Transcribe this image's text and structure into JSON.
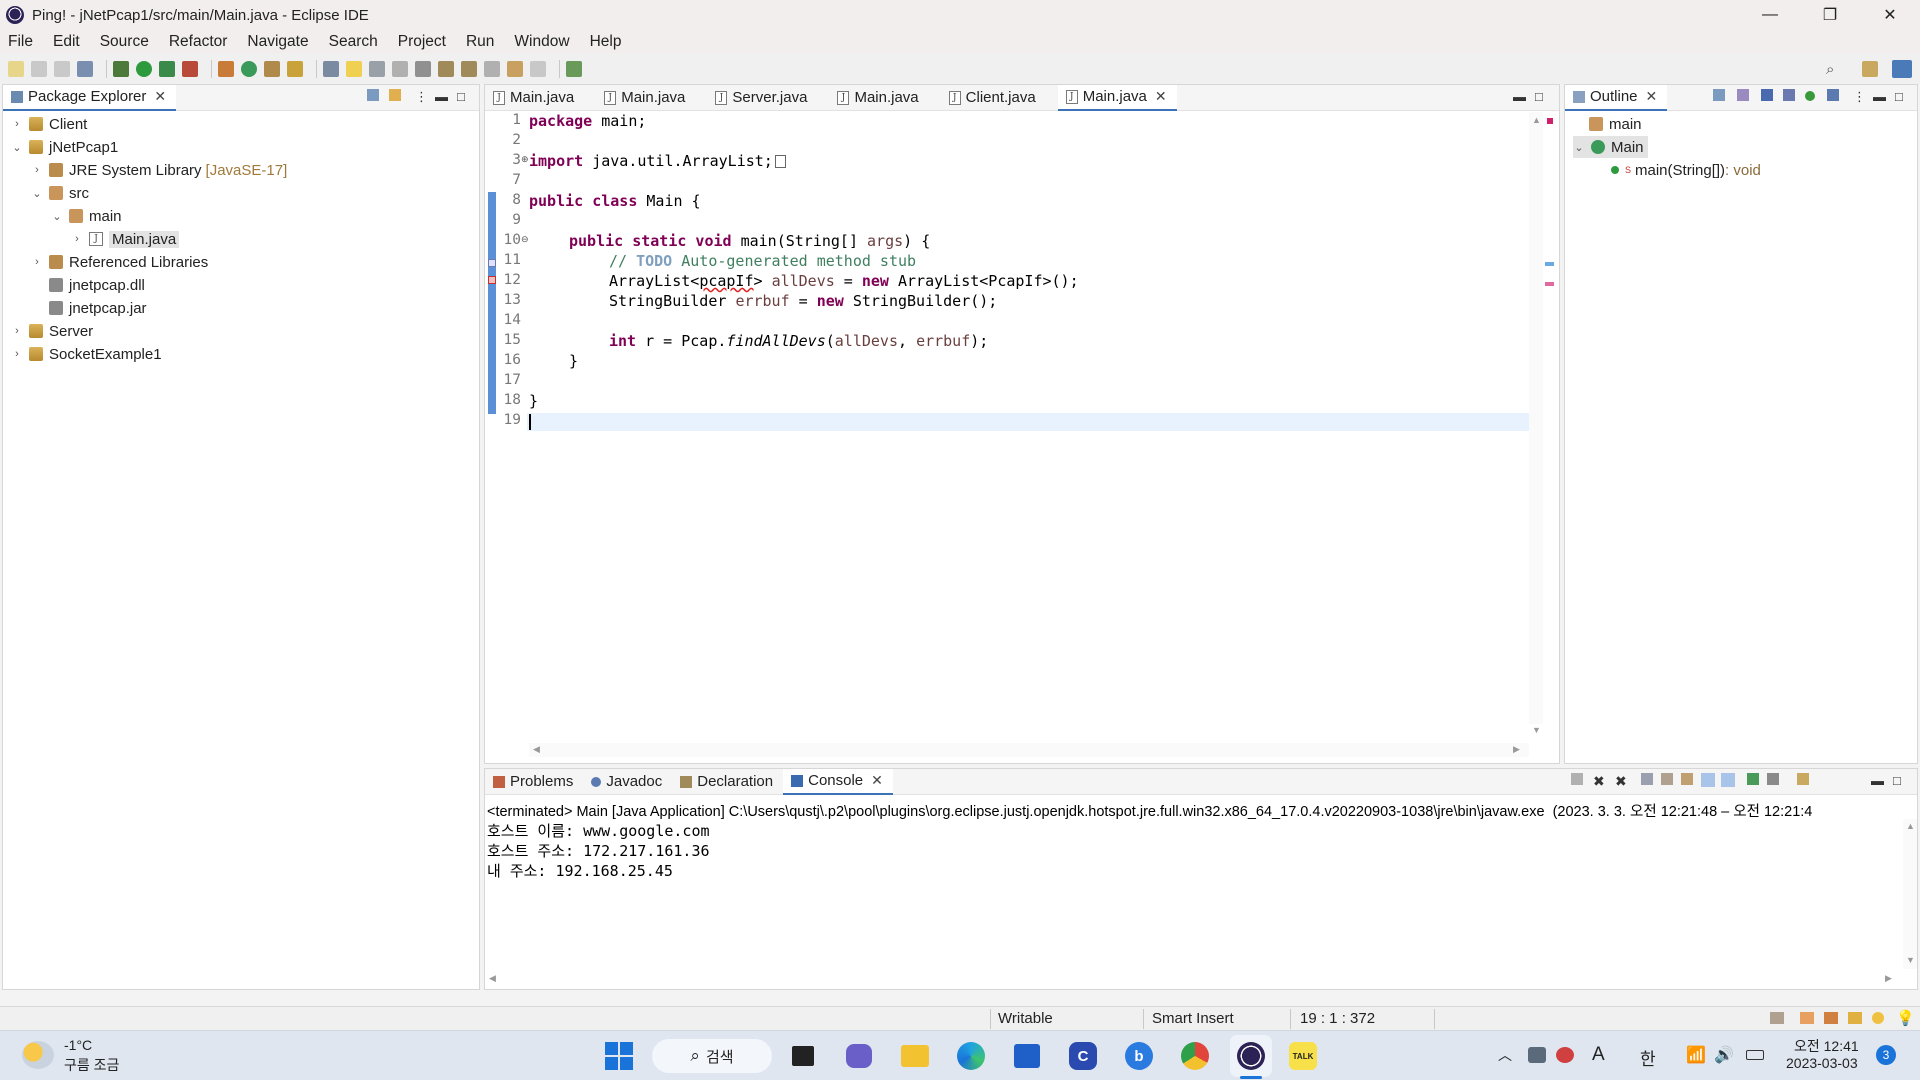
{
  "window": {
    "title": "Ping! - jNetPcap1/src/main/Main.java - Eclipse IDE",
    "minimize": "—",
    "restore": "❐",
    "close": "✕"
  },
  "menu": [
    "File",
    "Edit",
    "Source",
    "Refactor",
    "Navigate",
    "Search",
    "Project",
    "Run",
    "Window",
    "Help"
  ],
  "package_explorer": {
    "title": "Package Explorer",
    "tree": [
      {
        "label": "Client",
        "icon": "project-icon",
        "depth": 0,
        "chevron": "›"
      },
      {
        "label": "jNetPcap1",
        "icon": "project-icon",
        "depth": 0,
        "chevron": "⌄"
      },
      {
        "label": "JRE System Library",
        "suffix": "[JavaSE-17]",
        "icon": "library-icon",
        "depth": 1,
        "chevron": "›"
      },
      {
        "label": "src",
        "icon": "package-folder-icon",
        "depth": 1,
        "chevron": "⌄"
      },
      {
        "label": "main",
        "icon": "package-icon",
        "depth": 2,
        "chevron": "⌄"
      },
      {
        "label": "Main.java",
        "icon": "java-file-icon",
        "depth": 3,
        "chevron": "›",
        "selected": true
      },
      {
        "label": "Referenced Libraries",
        "icon": "library-icon",
        "depth": 1,
        "chevron": "›"
      },
      {
        "label": "jnetpcap.dll",
        "icon": "file-icon",
        "depth": 1,
        "chevron": ""
      },
      {
        "label": "jnetpcap.jar",
        "icon": "jar-icon",
        "depth": 1,
        "chevron": ""
      },
      {
        "label": "Server",
        "icon": "project-icon",
        "depth": 0,
        "chevron": "›"
      },
      {
        "label": "SocketExample1",
        "icon": "project-icon",
        "depth": 0,
        "chevron": "›"
      }
    ]
  },
  "editor": {
    "tabs": [
      {
        "label": "Main.java",
        "active": false
      },
      {
        "label": "Main.java",
        "active": false
      },
      {
        "label": "Server.java",
        "active": false
      },
      {
        "label": "Main.java",
        "active": false
      },
      {
        "label": "Client.java",
        "active": false
      },
      {
        "label": "Main.java",
        "active": true
      }
    ],
    "line_numbers": [
      "1",
      "2",
      "3",
      "7",
      "8",
      "9",
      "10",
      "11",
      "12",
      "13",
      "14",
      "15",
      "16",
      "17",
      "18",
      "19"
    ],
    "code": {
      "l1_kw": "package",
      "l1_rest": " main;",
      "l3_kw": "import",
      "l3_rest": " java.util.ArrayList;",
      "l8_kw": "public class",
      "l8_rest": " Main {",
      "l10_kw": "public static void",
      "l10_rest": " main(String[] ",
      "l10_var": "args",
      "l10_end": ") {",
      "l11_pre": "// ",
      "l11_todo": "TODO",
      "l11_rest": " Auto-generated method stub",
      "l12_a": "ArrayList<",
      "l12_err": "pcapIf",
      "l12_b": "> ",
      "l12_var": "allDevs",
      "l12_c": " = ",
      "l12_kw": "new",
      "l12_d": " ArrayList<PcapIf>();",
      "l13_a": "StringBuilder ",
      "l13_var": "errbuf",
      "l13_b": " = ",
      "l13_kw": "new",
      "l13_c": " StringBuilder();",
      "l15_kw": "int",
      "l15_a": " r = Pcap.",
      "l15_it": "findAllDevs",
      "l15_b": "(",
      "l15_v1": "allDevs",
      "l15_c": ", ",
      "l15_v2": "errbuf",
      "l15_d": ");",
      "l16": "}",
      "l18": "}"
    }
  },
  "outline": {
    "title": "Outline",
    "items": [
      {
        "label": "main",
        "icon": "package-icon"
      },
      {
        "label": "Main",
        "icon": "class-icon"
      },
      {
        "label": "main(String[])",
        "suffix": " : void",
        "icon": "method-icon"
      }
    ]
  },
  "bottom_tabs": [
    {
      "label": "Problems",
      "icon": "problems-icon"
    },
    {
      "label": "Javadoc",
      "icon": "javadoc-icon"
    },
    {
      "label": "Declaration",
      "icon": "declaration-icon"
    },
    {
      "label": "Console",
      "icon": "console-icon",
      "active": true
    }
  ],
  "console": {
    "header": "<terminated> Main [Java Application] C:\\Users\\qustj\\.p2\\pool\\plugins\\org.eclipse.justj.openjdk.hotspot.jre.full.win32.x86_64_17.0.4.v20220903-1038\\jre\\bin\\javaw.exe  (2023. 3. 3. 오전 12:21:48 – 오전 12:21:4",
    "lines": [
      "호스트 이름: www.google.com",
      "호스트 주소: 172.217.161.36",
      "내 주소: 192.168.25.45"
    ]
  },
  "status": {
    "writable": "Writable",
    "insert_mode": "Smart Insert",
    "position": "19 : 1 : 372"
  },
  "taskbar": {
    "weather_temp": "-1°C",
    "weather_desc": "구름 조금",
    "search_label": "검색",
    "ime": "한",
    "font_icon": "A",
    "time": "오전 12:41",
    "date": "2023-03-03",
    "notification_count": "3"
  },
  "colors": {
    "accent": "#3c73b8",
    "keyword": "#7f0055",
    "comment": "#3f7f5f",
    "variable": "#6a3e3e",
    "line_highlight": "#e8f2fe"
  }
}
